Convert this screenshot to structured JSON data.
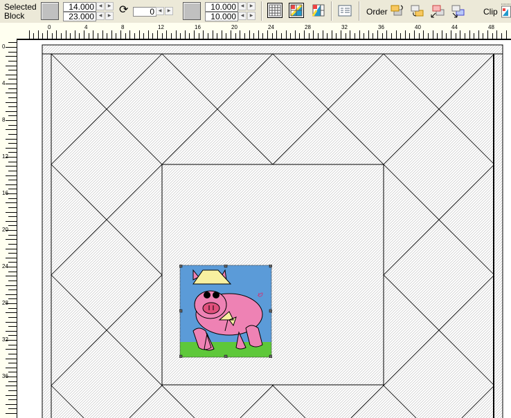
{
  "toolbar": {
    "selected_label_1": "Selected",
    "selected_label_2": "Block",
    "width_value": "14.000",
    "height_value": "23.000",
    "rotation_value": "0",
    "size_x_value": "10.000",
    "size_y_value": "10.000",
    "order_label": "Order",
    "clip_label": "Clip",
    "icons": [
      "rotate-icon",
      "grid-icon",
      "grid-colored-icon",
      "block-colored-icon",
      "properties-icon",
      "bring-forward-icon",
      "send-backward-icon",
      "bring-to-front-icon",
      "send-to-back-icon",
      "clip-icon"
    ]
  },
  "ruler": {
    "horizontal_labels": [
      "0",
      "4",
      "8",
      "12",
      "16",
      "20",
      "24",
      "28",
      "32",
      "36",
      "40",
      "44",
      "48"
    ],
    "vertical_labels": [
      "0",
      "4",
      "8",
      "12",
      "16",
      "20",
      "24",
      "28",
      "32",
      "36"
    ]
  },
  "canvas": {
    "selected_block": "pig applique",
    "colors": {
      "sky": "#5b9bd8",
      "pig": "#ee82b4",
      "hat": "#f7f0a0",
      "grass": "#5ec83a",
      "hatch": "#b8b8b8"
    }
  }
}
